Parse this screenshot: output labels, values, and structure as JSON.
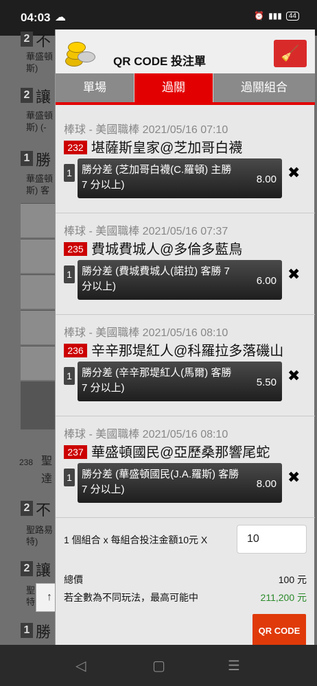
{
  "status": {
    "time": "04:03",
    "battery": "44"
  },
  "background": {
    "codes": [
      "238"
    ],
    "numbers": [
      "2",
      "2",
      "1",
      "2",
      "2",
      "1"
    ],
    "labels": [
      "不",
      "讓",
      "勝",
      "不",
      "讓",
      "勝"
    ],
    "small": [
      "華盛頓\n斯)",
      "華盛頓\n斯) (-",
      "華盛頓\n斯) 客",
      "聖路易\n特)",
      "聖\n特"
    ],
    "header_text": "聖",
    "header_sub": "達"
  },
  "panel": {
    "title": "QR CODE 投注單",
    "tabs": [
      "單場",
      "過關",
      "過關組合"
    ],
    "active_tab": "過關",
    "bets": [
      {
        "league": "棒球 - 美國職棒 2021/05/16 07:10",
        "code": "232",
        "match": "堪薩斯皇家@芝加哥白襪",
        "idx": "1",
        "desc": "勝分差 (芝加哥白襪(C.羅頓) 主勝 7 分以上)",
        "odds": "8.00"
      },
      {
        "league": "棒球 - 美國職棒 2021/05/16 07:37",
        "code": "235",
        "match": "費城費城人@多倫多藍鳥",
        "idx": "1",
        "desc": "勝分差 (費城費城人(諾拉) 客勝 7 分以上)",
        "odds": "6.00"
      },
      {
        "league": "棒球 - 美國職棒 2021/05/16 08:10",
        "code": "236",
        "match": "辛辛那堤紅人@科羅拉多落磯山",
        "idx": "1",
        "desc": "勝分差 (辛辛那堤紅人(馬爾) 客勝 7 分以上)",
        "odds": "5.50"
      },
      {
        "league": "棒球 - 美國職棒 2021/05/16 08:10",
        "code": "237",
        "match": "華盛頓國民@亞歷桑那響尾蛇",
        "idx": "1",
        "desc": "勝分差 (華盛頓國民(J.A.羅斯) 客勝 7 分以上)",
        "odds": "8.00"
      }
    ],
    "footer": {
      "combo_text": "1 個組合 x 每組合投注金額10元 X",
      "amount": "10",
      "total_label": "總價",
      "total_value": "100 元",
      "max_label": "若全數為不同玩法，最高可能中",
      "max_value": "211,200 元",
      "qr_button": "QR CODE"
    }
  },
  "colors": {
    "red": "#e30000",
    "qr_button": "#e03a0a",
    "green": "#2a8a2a"
  },
  "icons": {
    "clear": "broom-icon",
    "remove": "close-icon",
    "up": "arrow-up-icon"
  }
}
